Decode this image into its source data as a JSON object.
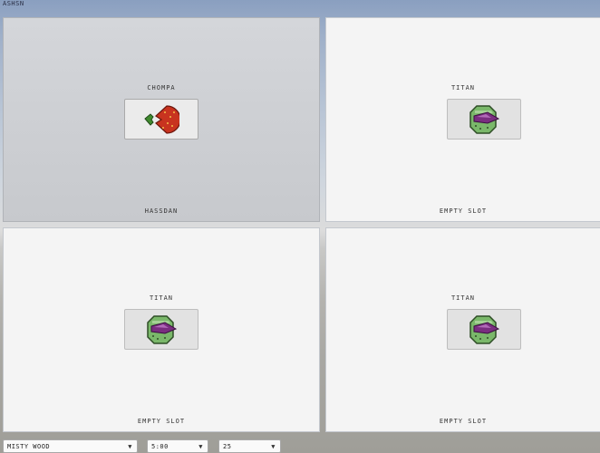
{
  "window": {
    "title": "ASHSN"
  },
  "slots": [
    {
      "character": "CHOMPA",
      "player": "HASSDAN",
      "active": true,
      "sprite": "chompa-sprite"
    },
    {
      "character": "TITAN",
      "player": "EMPTY SLOT",
      "active": false,
      "sprite": "titan-sprite"
    },
    {
      "character": "TITAN",
      "player": "EMPTY SLOT",
      "active": false,
      "sprite": "titan-sprite"
    },
    {
      "character": "TITAN",
      "player": "EMPTY SLOT",
      "active": false,
      "sprite": "titan-sprite"
    }
  ],
  "settings": {
    "stage": "MISTY WOOD",
    "time": "5:00",
    "count": "25"
  },
  "icons": {
    "dropdown": "chevron-down-icon"
  },
  "colors": {
    "chompa_body": "#c8331f",
    "chompa_leaf": "#3f8a2e",
    "titan_shell": "#7ab86a",
    "titan_crystal": "#7a2e80"
  }
}
